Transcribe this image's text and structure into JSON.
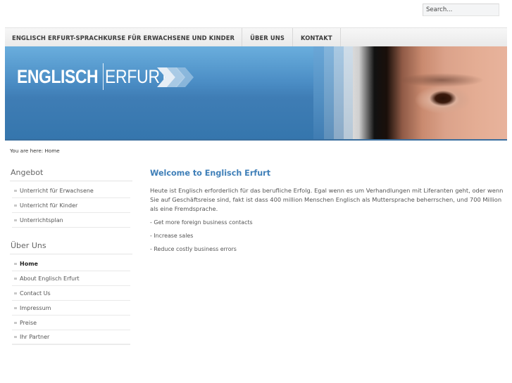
{
  "search": {
    "placeholder": "Search...",
    "value": "Search..."
  },
  "nav": {
    "items": [
      {
        "label": "ENGLISCH ERFURT-SPRACHKURSE FÜR ERWACHSENE UND KINDER"
      },
      {
        "label": "ÜBER UNS"
      },
      {
        "label": "KONTAKT"
      }
    ]
  },
  "header": {
    "logo_part1": "ENGLISCH",
    "logo_part2": "ERFURT",
    "colors": {
      "banner_top": "#6aaedd",
      "banner_bottom": "#3576ad"
    }
  },
  "breadcrumb": {
    "text": "You are here: Home"
  },
  "sidebar": {
    "sections": [
      {
        "title": "Angebot",
        "items": [
          {
            "label": "Unterricht für Erwachsene",
            "active": false
          },
          {
            "label": "Unterricht für Kinder",
            "active": false
          },
          {
            "label": "Unterrichtsplan",
            "active": false
          }
        ]
      },
      {
        "title": "Über Uns",
        "items": [
          {
            "label": "Home",
            "active": true
          },
          {
            "label": "About Englisch Erfurt",
            "active": false
          },
          {
            "label": "Contact Us",
            "active": false
          },
          {
            "label": "Impressum",
            "active": false
          },
          {
            "label": "Preise",
            "active": false
          },
          {
            "label": "Ihr Partner",
            "active": false
          }
        ]
      }
    ]
  },
  "main": {
    "title": "Welcome to Englisch Erfurt",
    "paragraph": "Heute ist Englisch erforderlich für das berufliche Erfolg. Egal wenn es um Verhandlungen mit Liferanten geht, oder wenn Sie auf Geschäftsreise sind, fakt ist dass 400 million Menschen Englisch als Muttersprache beherrschen, und 700 Million als eine Fremdsprache.",
    "bullets": [
      "- Get more foreign business contacts",
      "- Increase sales",
      "- Reduce costly business errors"
    ],
    "accent_color": "#3f7fb8"
  }
}
